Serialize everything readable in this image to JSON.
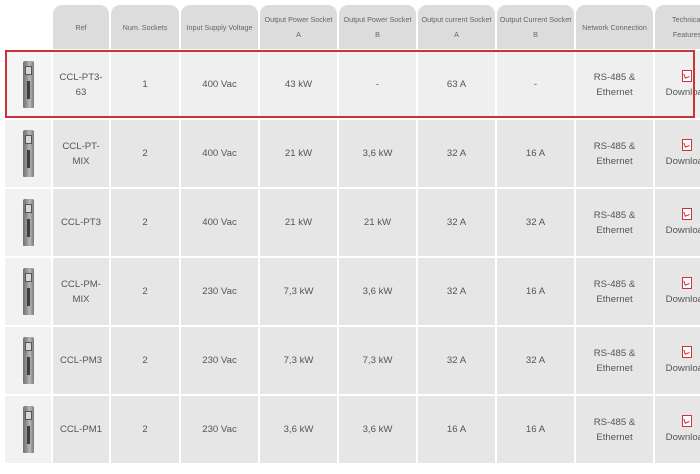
{
  "headers": [
    "",
    "Num. Sockets",
    "Input Supply Voltage",
    "Output Power Socket A",
    "Output Power Socket B",
    "Output current Socket A",
    "Output Current Socket B",
    "Network Connection",
    "Technical Features"
  ],
  "header_ref": "Ref",
  "rows": [
    {
      "ref": "CCL-PT3-63",
      "sockets": "1",
      "voltage": "400 Vac",
      "power_a": "43 kW",
      "power_b": "-",
      "current_a": "63 A",
      "current_b": "-",
      "network": "RS-485 & Ethernet",
      "download": "Download"
    },
    {
      "ref": "CCL-PT-MIX",
      "sockets": "2",
      "voltage": "400 Vac",
      "power_a": "21 kW",
      "power_b": "3,6 kW",
      "current_a": "32 A",
      "current_b": "16 A",
      "network": "RS-485 & Ethernet",
      "download": "Download"
    },
    {
      "ref": "CCL-PT3",
      "sockets": "2",
      "voltage": "400 Vac",
      "power_a": "21 kW",
      "power_b": "21 kW",
      "current_a": "32 A",
      "current_b": "32 A",
      "network": "RS-485 & Ethernet",
      "download": "Download"
    },
    {
      "ref": "CCL-PM-MIX",
      "sockets": "2",
      "voltage": "230 Vac",
      "power_a": "7,3 kW",
      "power_b": "3,6 kW",
      "current_a": "32 A",
      "current_b": "16 A",
      "network": "RS-485 & Ethernet",
      "download": "Download"
    },
    {
      "ref": "CCL-PM3",
      "sockets": "2",
      "voltage": "230 Vac",
      "power_a": "7,3 kW",
      "power_b": "7,3 kW",
      "current_a": "32 A",
      "current_b": "32 A",
      "network": "RS-485 & Ethernet",
      "download": "Download"
    },
    {
      "ref": "CCL-PM1",
      "sockets": "2",
      "voltage": "230 Vac",
      "power_a": "3,6 kW",
      "power_b": "3,6 kW",
      "current_a": "16 A",
      "current_b": "16 A",
      "network": "RS-485 & Ethernet",
      "download": "Download"
    }
  ],
  "colors": {
    "highlight": "#c8343a",
    "header_bg": "#dcdcdc",
    "cell_bg": "#e6e6e6"
  },
  "icons": {
    "product": "charger-image",
    "document": "pdf-icon"
  }
}
